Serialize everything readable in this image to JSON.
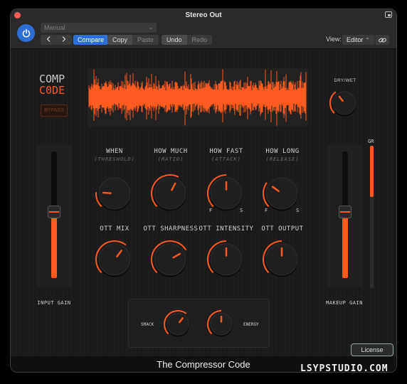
{
  "window": {
    "title": "Stereo Out"
  },
  "host": {
    "preset": "Manual",
    "compare_label": "Compare",
    "copy_label": "Copy",
    "paste_label": "Paste",
    "undo_label": "Undo",
    "redo_label": "Redo",
    "view_label": "View:",
    "view_value": "Editor",
    "back_icon": "chevron-left-icon",
    "forward_icon": "chevron-right-icon"
  },
  "plugin": {
    "logo_line1": "COMP",
    "logo_line2": "C0DE",
    "bypass_label": "BYPASS",
    "drywet_label": "DRY/WET",
    "gr_label": "GR",
    "accent_color": "#ff5a1f",
    "top_knobs": [
      {
        "label": "WHEN",
        "sub": "(THRESHOLD)",
        "value": 0.18
      },
      {
        "label": "HOW MUCH",
        "sub": "(RATIO)",
        "value": 0.6
      },
      {
        "label": "HOW FAST",
        "sub": "(ATTACK)",
        "value": 0.5,
        "left": "F",
        "right": "S"
      },
      {
        "label": "HOW LONG",
        "sub": "(RELEASE)",
        "value": 0.3,
        "left": "F",
        "right": "S"
      }
    ],
    "ott_knobs": [
      {
        "label": "OTT MIX",
        "value": 0.64
      },
      {
        "label": "OTT SHARPNESS",
        "value": 0.72
      },
      {
        "label": "OTT INTENSITY",
        "value": 0.5
      },
      {
        "label": "OTT OUTPUT",
        "value": 0.5
      }
    ],
    "drywet_value": 0.36,
    "input_gain": {
      "label": "INPUT GAIN",
      "value": 0.52
    },
    "makeup_gain": {
      "label": "MAKEUP GAIN",
      "value": 0.52
    },
    "gr_value": 0.36,
    "smack": {
      "label": "SMACK",
      "value": 0.64
    },
    "energy": {
      "label": "ENERGY",
      "value": 0.5
    },
    "license_label": "License",
    "footer_title": "The Compressor Code"
  },
  "watermark": "LSYPSTUDIO.COM"
}
